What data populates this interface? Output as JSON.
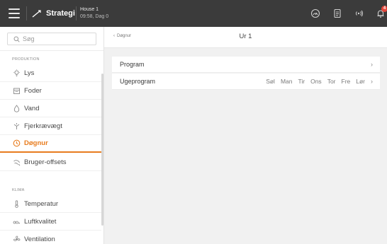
{
  "topbar": {
    "brand_label": "Strategi",
    "house_name": "House 1",
    "house_time": "09:58, Dag 0",
    "notification_count": "4"
  },
  "sidebar": {
    "search_placeholder": "Søg",
    "sections": [
      {
        "label": "PRODUKTION",
        "items": [
          {
            "label": "Lys",
            "icon": "light-bulb-icon"
          },
          {
            "label": "Foder",
            "icon": "feed-icon"
          },
          {
            "label": "Vand",
            "icon": "water-drop-icon"
          },
          {
            "label": "Fjerkrævægt",
            "icon": "weight-icon"
          },
          {
            "label": "Døgnur",
            "icon": "clock-icon",
            "active": true
          },
          {
            "label": "Bruger-offsets",
            "icon": "offset-icon"
          }
        ]
      },
      {
        "label": "KLIMA",
        "items": [
          {
            "label": "Temperatur",
            "icon": "thermometer-icon"
          },
          {
            "label": "Luftkvalitet",
            "icon": "air-quality-icon"
          },
          {
            "label": "Ventilation",
            "icon": "fan-icon"
          }
        ]
      }
    ]
  },
  "content": {
    "back_label": "Døgnur",
    "title": "Ur 1",
    "rows": {
      "program": {
        "label": "Program"
      },
      "ugeprogram": {
        "label": "Ugeprogram",
        "days": [
          "Søl",
          "Man",
          "Tir",
          "Ons",
          "Tor",
          "Fre",
          "Lør"
        ]
      }
    }
  },
  "colors": {
    "topbar": "#3b3b3b",
    "accent": "#e87c1e",
    "badge": "#e2463b",
    "background": "#f1f1f1"
  }
}
